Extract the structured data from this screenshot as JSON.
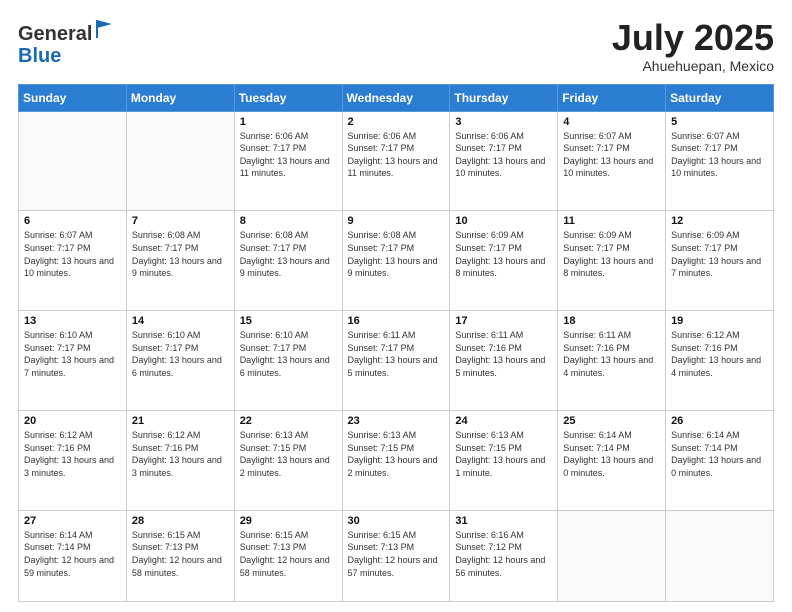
{
  "logo": {
    "general": "General",
    "blue": "Blue"
  },
  "title": {
    "month_year": "July 2025",
    "location": "Ahuehuepan, Mexico"
  },
  "weekdays": [
    "Sunday",
    "Monday",
    "Tuesday",
    "Wednesday",
    "Thursday",
    "Friday",
    "Saturday"
  ],
  "weeks": [
    [
      {
        "day": "",
        "info": ""
      },
      {
        "day": "",
        "info": ""
      },
      {
        "day": "1",
        "info": "Sunrise: 6:06 AM\nSunset: 7:17 PM\nDaylight: 13 hours and 11 minutes."
      },
      {
        "day": "2",
        "info": "Sunrise: 6:06 AM\nSunset: 7:17 PM\nDaylight: 13 hours and 11 minutes."
      },
      {
        "day": "3",
        "info": "Sunrise: 6:06 AM\nSunset: 7:17 PM\nDaylight: 13 hours and 10 minutes."
      },
      {
        "day": "4",
        "info": "Sunrise: 6:07 AM\nSunset: 7:17 PM\nDaylight: 13 hours and 10 minutes."
      },
      {
        "day": "5",
        "info": "Sunrise: 6:07 AM\nSunset: 7:17 PM\nDaylight: 13 hours and 10 minutes."
      }
    ],
    [
      {
        "day": "6",
        "info": "Sunrise: 6:07 AM\nSunset: 7:17 PM\nDaylight: 13 hours and 10 minutes."
      },
      {
        "day": "7",
        "info": "Sunrise: 6:08 AM\nSunset: 7:17 PM\nDaylight: 13 hours and 9 minutes."
      },
      {
        "day": "8",
        "info": "Sunrise: 6:08 AM\nSunset: 7:17 PM\nDaylight: 13 hours and 9 minutes."
      },
      {
        "day": "9",
        "info": "Sunrise: 6:08 AM\nSunset: 7:17 PM\nDaylight: 13 hours and 9 minutes."
      },
      {
        "day": "10",
        "info": "Sunrise: 6:09 AM\nSunset: 7:17 PM\nDaylight: 13 hours and 8 minutes."
      },
      {
        "day": "11",
        "info": "Sunrise: 6:09 AM\nSunset: 7:17 PM\nDaylight: 13 hours and 8 minutes."
      },
      {
        "day": "12",
        "info": "Sunrise: 6:09 AM\nSunset: 7:17 PM\nDaylight: 13 hours and 7 minutes."
      }
    ],
    [
      {
        "day": "13",
        "info": "Sunrise: 6:10 AM\nSunset: 7:17 PM\nDaylight: 13 hours and 7 minutes."
      },
      {
        "day": "14",
        "info": "Sunrise: 6:10 AM\nSunset: 7:17 PM\nDaylight: 13 hours and 6 minutes."
      },
      {
        "day": "15",
        "info": "Sunrise: 6:10 AM\nSunset: 7:17 PM\nDaylight: 13 hours and 6 minutes."
      },
      {
        "day": "16",
        "info": "Sunrise: 6:11 AM\nSunset: 7:17 PM\nDaylight: 13 hours and 5 minutes."
      },
      {
        "day": "17",
        "info": "Sunrise: 6:11 AM\nSunset: 7:16 PM\nDaylight: 13 hours and 5 minutes."
      },
      {
        "day": "18",
        "info": "Sunrise: 6:11 AM\nSunset: 7:16 PM\nDaylight: 13 hours and 4 minutes."
      },
      {
        "day": "19",
        "info": "Sunrise: 6:12 AM\nSunset: 7:16 PM\nDaylight: 13 hours and 4 minutes."
      }
    ],
    [
      {
        "day": "20",
        "info": "Sunrise: 6:12 AM\nSunset: 7:16 PM\nDaylight: 13 hours and 3 minutes."
      },
      {
        "day": "21",
        "info": "Sunrise: 6:12 AM\nSunset: 7:16 PM\nDaylight: 13 hours and 3 minutes."
      },
      {
        "day": "22",
        "info": "Sunrise: 6:13 AM\nSunset: 7:15 PM\nDaylight: 13 hours and 2 minutes."
      },
      {
        "day": "23",
        "info": "Sunrise: 6:13 AM\nSunset: 7:15 PM\nDaylight: 13 hours and 2 minutes."
      },
      {
        "day": "24",
        "info": "Sunrise: 6:13 AM\nSunset: 7:15 PM\nDaylight: 13 hours and 1 minute."
      },
      {
        "day": "25",
        "info": "Sunrise: 6:14 AM\nSunset: 7:14 PM\nDaylight: 13 hours and 0 minutes."
      },
      {
        "day": "26",
        "info": "Sunrise: 6:14 AM\nSunset: 7:14 PM\nDaylight: 13 hours and 0 minutes."
      }
    ],
    [
      {
        "day": "27",
        "info": "Sunrise: 6:14 AM\nSunset: 7:14 PM\nDaylight: 12 hours and 59 minutes."
      },
      {
        "day": "28",
        "info": "Sunrise: 6:15 AM\nSunset: 7:13 PM\nDaylight: 12 hours and 58 minutes."
      },
      {
        "day": "29",
        "info": "Sunrise: 6:15 AM\nSunset: 7:13 PM\nDaylight: 12 hours and 58 minutes."
      },
      {
        "day": "30",
        "info": "Sunrise: 6:15 AM\nSunset: 7:13 PM\nDaylight: 12 hours and 57 minutes."
      },
      {
        "day": "31",
        "info": "Sunrise: 6:16 AM\nSunset: 7:12 PM\nDaylight: 12 hours and 56 minutes."
      },
      {
        "day": "",
        "info": ""
      },
      {
        "day": "",
        "info": ""
      }
    ]
  ]
}
